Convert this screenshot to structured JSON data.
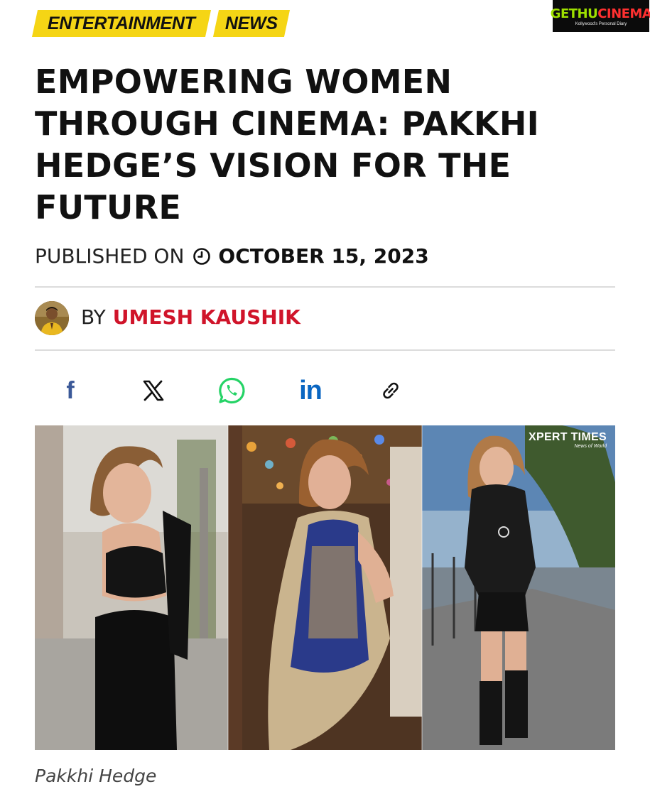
{
  "tags": {
    "category1": "ENTERTAINMENT",
    "category2": "NEWS"
  },
  "logo": {
    "part1": "GETHU",
    "part2": "CINEMA",
    "tagline": "Kollywood's Personal Diary"
  },
  "article": {
    "headline": "EMPOWERING WOMEN THROUGH CINEMA: PAKKHI HEDGE’S VISION FOR THE FUTURE",
    "published_label": "PUBLISHED ON",
    "published_date": "OCTOBER 15, 2023",
    "by_label": "BY",
    "author": "UMESH KAUSHIK"
  },
  "share": {
    "icons": [
      "facebook-icon",
      "x-icon",
      "whatsapp-icon",
      "linkedin-icon",
      "link-icon"
    ],
    "facebook_glyph": "f",
    "linkedin_glyph": "in"
  },
  "image": {
    "watermark_title": "XPERT TIMES",
    "watermark_subtitle": "News of World",
    "caption": "Pakkhi Hedge"
  },
  "colors": {
    "tag_yellow": "#f5d515",
    "author_red": "#d0142a",
    "facebook_blue": "#3b5998",
    "whatsapp_green": "#25d366",
    "linkedin_blue": "#0a66c2"
  }
}
